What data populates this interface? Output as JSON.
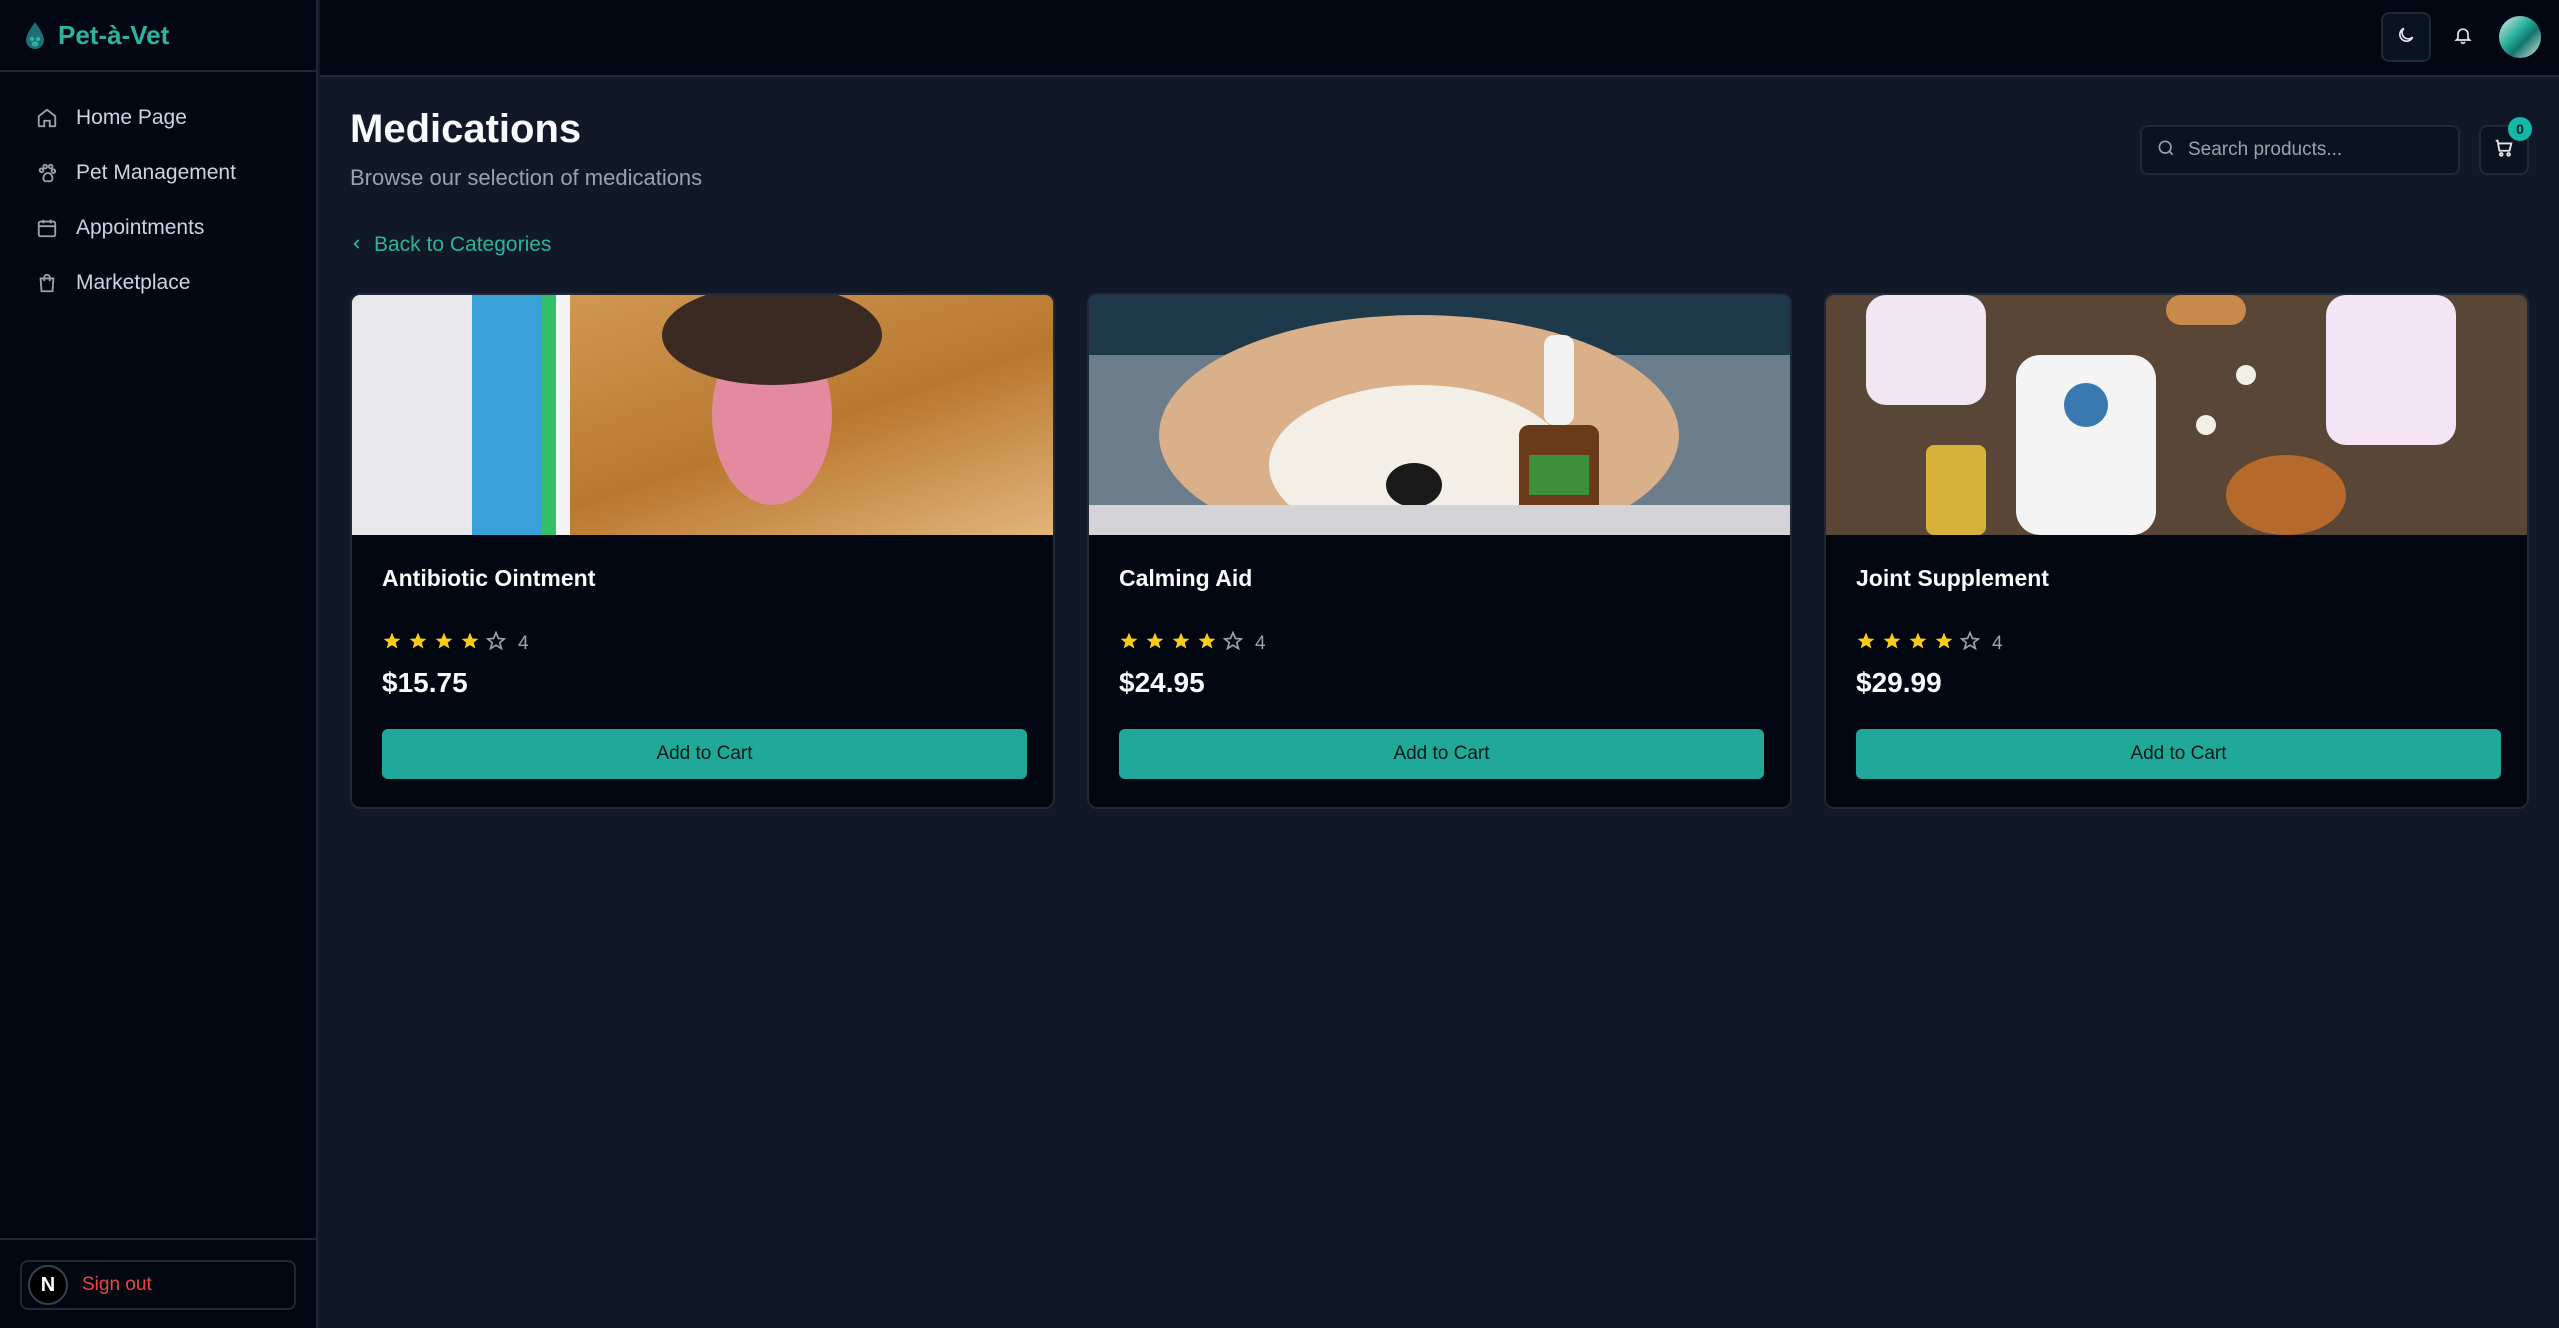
{
  "app": {
    "name": "Pet-à-Vet"
  },
  "sidebar": {
    "items": [
      {
        "label": "Home Page",
        "icon": "home-icon"
      },
      {
        "label": "Pet Management",
        "icon": "paw-icon"
      },
      {
        "label": "Appointments",
        "icon": "calendar-icon"
      },
      {
        "label": "Marketplace",
        "icon": "shopping-bag-icon"
      }
    ],
    "footer": {
      "avatar_letter": "N",
      "signout_label": "Sign out"
    }
  },
  "header": {
    "title": "Medications",
    "subtitle": "Browse our selection of medications",
    "search_placeholder": "Search products...",
    "cart_count": "0",
    "back_label": "Back to Categories"
  },
  "products": [
    {
      "name": "Antibiotic Ointment",
      "rating": 4,
      "rating_text": "4",
      "price": "$15.75",
      "button": "Add to Cart"
    },
    {
      "name": "Calming Aid",
      "rating": 4,
      "rating_text": "4",
      "price": "$24.95",
      "button": "Add to Cart"
    },
    {
      "name": "Joint Supplement",
      "rating": 4,
      "rating_text": "4",
      "price": "$29.99",
      "button": "Add to Cart"
    }
  ],
  "colors": {
    "accent": "#2db3a0",
    "button": "#20a899",
    "star": "#facc15",
    "danger": "#ef4444"
  }
}
